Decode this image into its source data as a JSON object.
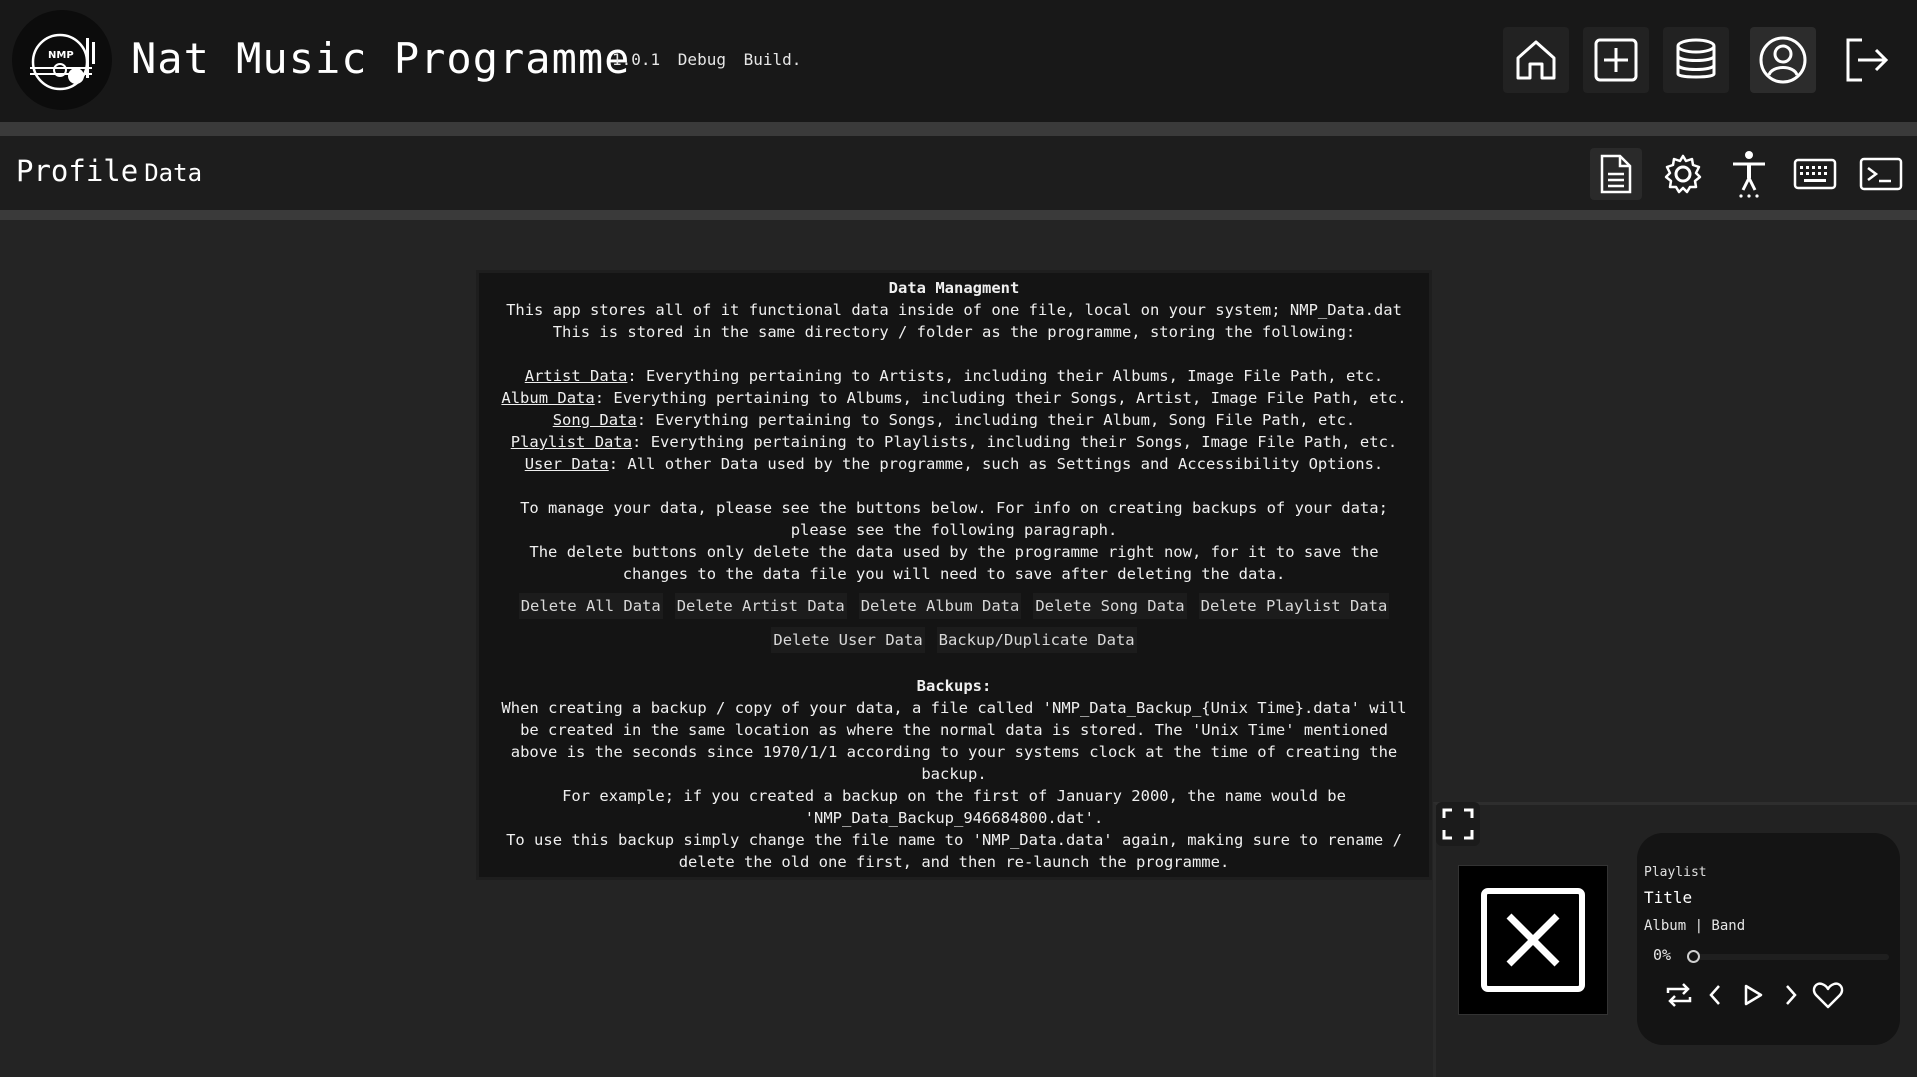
{
  "app": {
    "title": "Nat Music Programme",
    "version": "1.0.1  Debug Build.",
    "logo_text": "NMP"
  },
  "nav": [
    {
      "name": "home-icon"
    },
    {
      "name": "add-icon"
    },
    {
      "name": "database-icon"
    },
    {
      "name": "profile-icon"
    },
    {
      "name": "logout-icon"
    }
  ],
  "subheader": {
    "title": "Profile",
    "subtitle": "Data",
    "buttons": [
      {
        "name": "document-icon"
      },
      {
        "name": "gear-icon"
      },
      {
        "name": "accessibility-icon"
      },
      {
        "name": "keyboard-icon"
      },
      {
        "name": "terminal-icon"
      }
    ]
  },
  "panel": {
    "heading": "Data Managment",
    "intro": [
      "This app stores all of it functional data inside of one file, local on your system; NMP_Data.dat",
      "This is stored in the same directory / folder as the programme, storing the following:"
    ],
    "items": [
      {
        "label": "Artist Data",
        "text": ": Everything pertaining to Artists, including their Albums, Image File Path, etc."
      },
      {
        "label": "Album Data",
        "text": ": Everything pertaining to Albums, including their Songs, Artist, Image File Path, etc."
      },
      {
        "label": "Song Data",
        "text": ": Everything pertaining to Songs, including their Album, Song File Path, etc."
      },
      {
        "label": "Playlist Data",
        "text": ": Everything pertaining to Playlists, including their Songs, Image File Path, etc."
      },
      {
        "label": "User Data",
        "text": ": All other Data used by the programme, such as Settings and Accessibility Options."
      }
    ],
    "manage": [
      "To manage your data, please see the buttons below. For info on creating backups of your data;",
      "please see the following paragraph.",
      "The delete buttons only delete the data used by the programme right now, for it to save the",
      "changes to the data file you will need to save after deleting the data."
    ],
    "buttons_row1": [
      "Delete All Data",
      "Delete Artist Data",
      "Delete Album Data",
      "Delete Song Data",
      "Delete Playlist Data"
    ],
    "buttons_row2": [
      "Delete User Data",
      "Backup/Duplicate Data"
    ],
    "backups_heading": "Backups:",
    "backups": [
      "When creating a backup / copy of your data, a file called 'NMP_Data_Backup_{Unix Time}.data' will",
      "be created in the same location as where the normal data is stored. The 'Unix Time' mentioned",
      "above is the seconds since 1970/1/1 according to your systems clock at the time of creating the",
      "backup.",
      "For example; if you created a backup on the first of January 2000, the name would be",
      "'NMP_Data_Backup_946684800.dat'.",
      "To use this backup simply change the file name to 'NMP_Data.data' again, making sure to rename /",
      "delete the old one first, and then re-launch the programme."
    ]
  },
  "player": {
    "context": "Playlist",
    "title": "Title",
    "subtitle": "Album | Band",
    "progress_text": "0%",
    "progress": 0,
    "controls": [
      "repeat-icon",
      "previous-icon",
      "play-icon",
      "next-icon",
      "heart-icon"
    ]
  }
}
